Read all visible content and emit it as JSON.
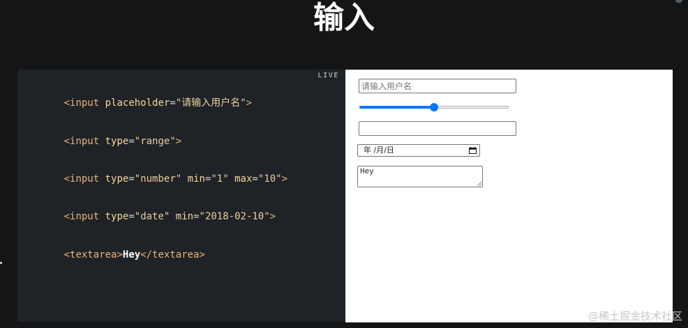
{
  "slide": {
    "title": "输入"
  },
  "code_panel": {
    "live_label": "LIVE",
    "lines": [
      {
        "open": "<",
        "tag": "input",
        "attr1": "placeholder",
        "val1": "\"请输入用户名\"",
        "close": ">"
      },
      {
        "open": "<",
        "tag": "input",
        "attr1": "type",
        "val1": "\"range\"",
        "close": ">"
      },
      {
        "open": "<",
        "tag": "input",
        "attr1": "type",
        "val1": "\"number\"",
        "attr2": "min",
        "val2": "\"1\"",
        "attr3": "max",
        "val3": "\"10\"",
        "close": ">"
      },
      {
        "open": "<",
        "tag": "input",
        "attr1": "type",
        "val1": "\"date\"",
        "attr2": "min",
        "val2": "\"2018-02-10\"",
        "close": ">"
      },
      {
        "open": "<",
        "tag": "textarea",
        "close": ">",
        "content": "Hey",
        "end_tag": "</textarea>"
      }
    ]
  },
  "preview": {
    "text_input": {
      "placeholder": "请输入用户名",
      "value": ""
    },
    "range": {
      "value_fraction": 0.5
    },
    "number_input": {
      "value": ""
    },
    "date_input": {
      "display": "年 /月/日"
    },
    "textarea": {
      "value": "Hey"
    },
    "icons": {
      "calendar": "calendar-icon",
      "resize": "resize-handle-icon"
    },
    "colors": {
      "accent": "#0075ff"
    }
  },
  "watermark": {
    "text": "@稀土掘金技术社区"
  }
}
